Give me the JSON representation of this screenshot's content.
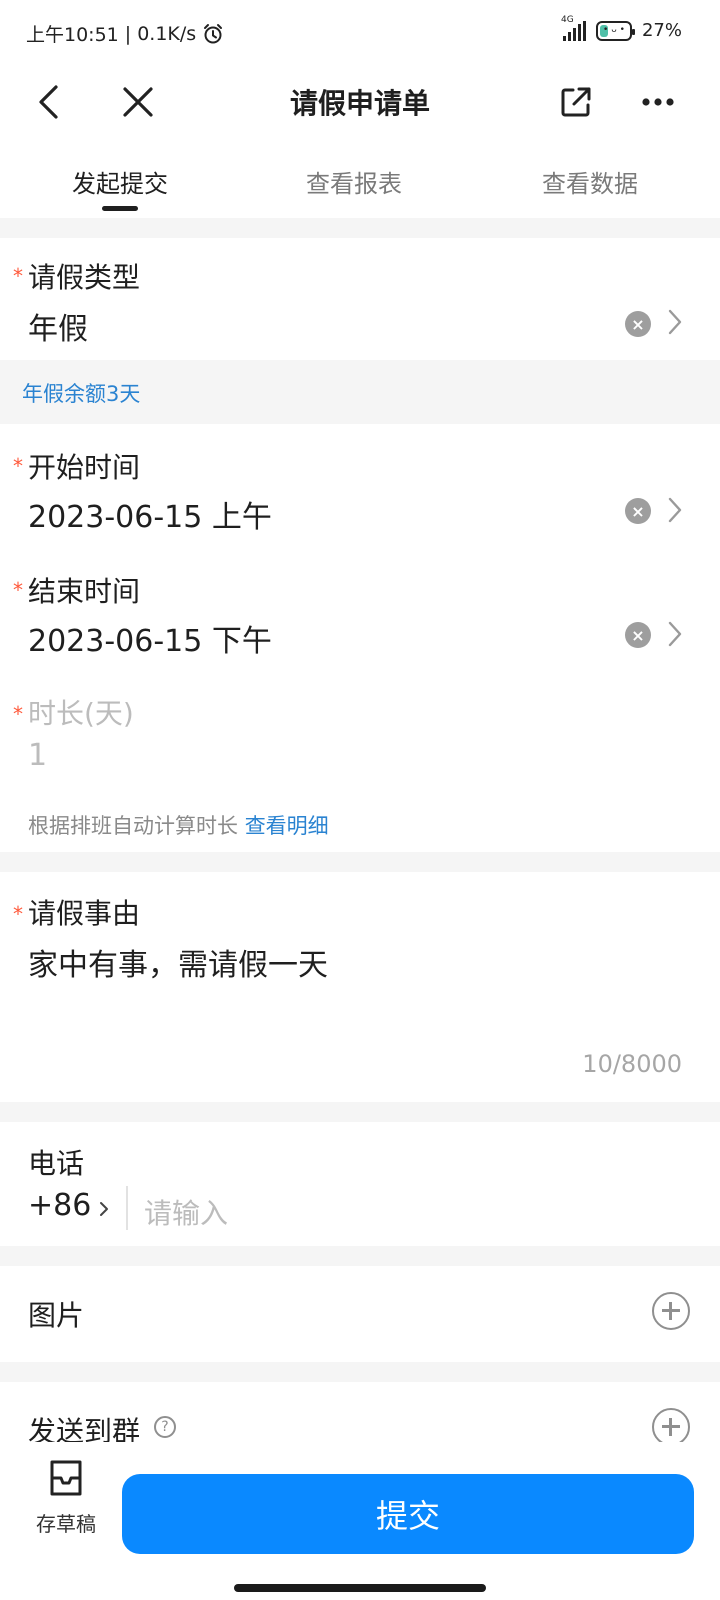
{
  "status": {
    "time": "上午10:51",
    "speed": "| 0.1K/s",
    "network": "4G",
    "battery": "27%",
    "battery_level": 0.27
  },
  "nav": {
    "title": "请假申请单"
  },
  "tabs": [
    {
      "label": "发起提交",
      "active": true
    },
    {
      "label": "查看报表",
      "active": false
    },
    {
      "label": "查看数据",
      "active": false
    }
  ],
  "form": {
    "leave_type": {
      "label": "请假类型",
      "value": "年假",
      "required": "*"
    },
    "balance_note": "年假余额3天",
    "start_time": {
      "label": "开始时间",
      "value": "2023-06-15 上午",
      "required": "*"
    },
    "end_time": {
      "label": "结束时间",
      "value": "2023-06-15 下午",
      "required": "*"
    },
    "duration": {
      "label": "时长(天)",
      "value": "1",
      "required": "*",
      "hint": "根据排班自动计算时长",
      "hint_link": "查看明细"
    },
    "reason": {
      "label": "请假事由",
      "value": "家中有事，需请假一天",
      "required": "*",
      "counter": "10/8000"
    },
    "phone": {
      "label": "电话",
      "country_code": "+86",
      "placeholder": "请输入"
    },
    "images": {
      "label": "图片"
    },
    "send_to_group": {
      "label": "发送到群"
    }
  },
  "bottom": {
    "draft_label": "存草稿",
    "submit_label": "提交"
  },
  "colors": {
    "accent": "#0a89ff",
    "link": "#2a83d1",
    "required": "#ff5a3c"
  }
}
